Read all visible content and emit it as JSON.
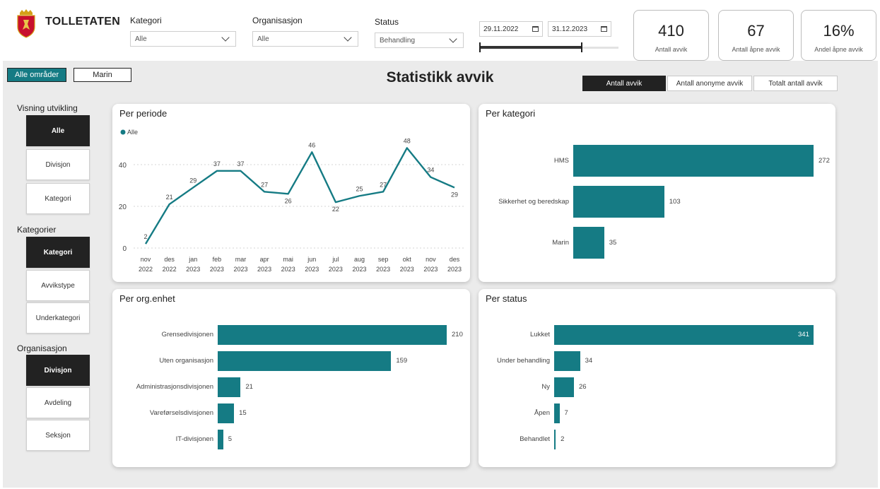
{
  "header": {
    "brand": "TOLLETATEN",
    "filters": [
      {
        "label": "Kategori",
        "value": "Alle"
      },
      {
        "label": "Organisasjon",
        "value": "Alle"
      },
      {
        "label": "Status",
        "value": "Behandling"
      }
    ],
    "date_from": "29.11.2022",
    "date_to": "31.12.2023"
  },
  "kpis": [
    {
      "value": "410",
      "label": "Antall avvik"
    },
    {
      "value": "67",
      "label": "Antall åpne avvik"
    },
    {
      "value": "16%",
      "label": "Andel åpne avvik"
    }
  ],
  "area_tabs": [
    "Alle områder",
    "Marin"
  ],
  "page_title": "Statistikk avvik",
  "measure_toggles": [
    "Antall avvik",
    "Antall anonyme avvik",
    "Totalt antall avvik"
  ],
  "sidebar": {
    "groups": [
      {
        "label": "Visning utvikling",
        "buttons": [
          "Alle",
          "Divisjon",
          "Kategori"
        ]
      },
      {
        "label": "Kategorier",
        "buttons": [
          "Kategori",
          "Avvikstype",
          "Underkategori"
        ]
      },
      {
        "label": "Organisasjon",
        "buttons": [
          "Divisjon",
          "Avdeling",
          "Seksjon"
        ]
      }
    ]
  },
  "colors": {
    "accent": "#157b84",
    "dark": "#222222"
  },
  "chart_data": [
    {
      "type": "line",
      "title": "Per periode",
      "legend": "Alle",
      "x": [
        [
          "nov",
          "2022"
        ],
        [
          "des",
          "2022"
        ],
        [
          "jan",
          "2023"
        ],
        [
          "feb",
          "2023"
        ],
        [
          "mar",
          "2023"
        ],
        [
          "apr",
          "2023"
        ],
        [
          "mai",
          "2023"
        ],
        [
          "jun",
          "2023"
        ],
        [
          "jul",
          "2023"
        ],
        [
          "aug",
          "2023"
        ],
        [
          "sep",
          "2023"
        ],
        [
          "okt",
          "2023"
        ],
        [
          "nov",
          "2023"
        ],
        [
          "des",
          "2023"
        ]
      ],
      "series": [
        {
          "name": "Alle",
          "values": [
            2,
            21,
            29,
            37,
            37,
            27,
            26,
            46,
            22,
            25,
            27,
            48,
            34,
            29
          ]
        }
      ],
      "yticks": [
        0,
        20,
        40
      ],
      "ylim": [
        0,
        50
      ]
    },
    {
      "type": "bar",
      "title": "Per kategori",
      "categories": [
        "HMS",
        "Sikkerhet og beredskap",
        "Marin"
      ],
      "values": [
        272,
        103,
        35
      ]
    },
    {
      "type": "bar",
      "title": "Per org.enhet",
      "categories": [
        "Grensedivisjonen",
        "Uten organisasjon",
        "Administrasjonsdivisjonen",
        "Vareførselsdivisjonen",
        "IT-divisjonen"
      ],
      "values": [
        210,
        159,
        21,
        15,
        5
      ]
    },
    {
      "type": "bar",
      "title": "Per status",
      "categories": [
        "Lukket",
        "Under behandling",
        "Ny",
        "Åpen",
        "Behandlet"
      ],
      "values": [
        341,
        34,
        26,
        7,
        2
      ]
    }
  ]
}
